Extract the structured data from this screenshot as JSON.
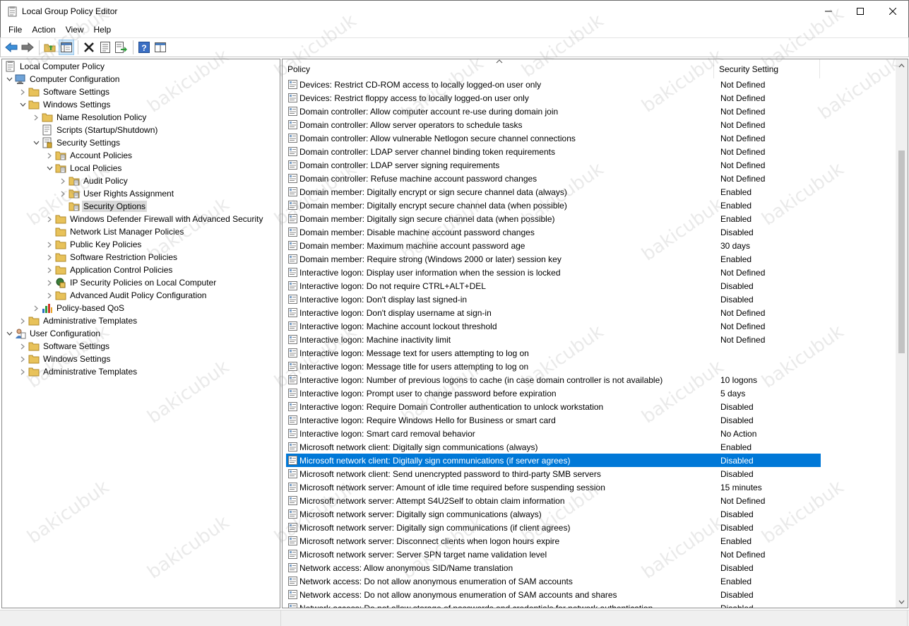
{
  "window": {
    "title": "Local Group Policy Editor",
    "minimize_icon": "minimize-icon",
    "maximize_icon": "maximize-icon",
    "close_icon": "close-icon"
  },
  "menu": [
    "File",
    "Action",
    "View",
    "Help"
  ],
  "toolbar": {
    "buttons": [
      "back-arrow-icon",
      "forward-arrow-icon",
      "up-folder-icon",
      "show-hide-tree-icon",
      "delete-icon",
      "properties-icon",
      "export-list-icon",
      "help-icon",
      "console-view-icon"
    ]
  },
  "tree": {
    "nodes": [
      {
        "label": "Local Computer Policy",
        "icon": "policy-root-icon"
      },
      {
        "label": "Computer Configuration",
        "icon": "computer-icon"
      },
      {
        "label": "Software Settings",
        "icon": "folder-icon"
      },
      {
        "label": "Windows Settings",
        "icon": "folder-icon"
      },
      {
        "label": "Name Resolution Policy",
        "icon": "folder-icon"
      },
      {
        "label": "Scripts (Startup/Shutdown)",
        "icon": "script-icon"
      },
      {
        "label": "Security Settings",
        "icon": "security-settings-icon"
      },
      {
        "label": "Account Policies",
        "icon": "policy-folder-icon"
      },
      {
        "label": "Local Policies",
        "icon": "policy-folder-icon"
      },
      {
        "label": "Audit Policy",
        "icon": "policy-folder-icon"
      },
      {
        "label": "User Rights Assignment",
        "icon": "policy-folder-icon"
      },
      {
        "label": "Security Options",
        "icon": "policy-folder-icon"
      },
      {
        "label": "Windows Defender Firewall with Advanced Security",
        "icon": "folder-icon"
      },
      {
        "label": "Network List Manager Policies",
        "icon": "folder-icon"
      },
      {
        "label": "Public Key Policies",
        "icon": "folder-icon"
      },
      {
        "label": "Software Restriction Policies",
        "icon": "folder-icon"
      },
      {
        "label": "Application Control Policies",
        "icon": "folder-icon"
      },
      {
        "label": "IP Security Policies on Local Computer",
        "icon": "ipsec-icon"
      },
      {
        "label": "Advanced Audit Policy Configuration",
        "icon": "folder-icon"
      },
      {
        "label": "Policy-based QoS",
        "icon": "qos-chart-icon"
      },
      {
        "label": "Administrative Templates",
        "icon": "folder-icon"
      },
      {
        "label": "User Configuration",
        "icon": "user-icon"
      },
      {
        "label": "Software Settings",
        "icon": "folder-icon"
      },
      {
        "label": "Windows Settings",
        "icon": "folder-icon"
      },
      {
        "label": "Administrative Templates",
        "icon": "folder-icon"
      }
    ]
  },
  "list": {
    "columns": [
      "Policy",
      "Security Setting"
    ],
    "selected_index": 28,
    "rows": [
      {
        "policy": "Devices: Restrict CD-ROM access to locally logged-on user only",
        "setting": "Not Defined"
      },
      {
        "policy": "Devices: Restrict floppy access to locally logged-on user only",
        "setting": "Not Defined"
      },
      {
        "policy": "Domain controller: Allow computer account re-use during domain join",
        "setting": "Not Defined"
      },
      {
        "policy": "Domain controller: Allow server operators to schedule tasks",
        "setting": "Not Defined"
      },
      {
        "policy": "Domain controller: Allow vulnerable Netlogon secure channel connections",
        "setting": "Not Defined"
      },
      {
        "policy": "Domain controller: LDAP server channel binding token requirements",
        "setting": "Not Defined"
      },
      {
        "policy": "Domain controller: LDAP server signing requirements",
        "setting": "Not Defined"
      },
      {
        "policy": "Domain controller: Refuse machine account password changes",
        "setting": "Not Defined"
      },
      {
        "policy": "Domain member: Digitally encrypt or sign secure channel data (always)",
        "setting": "Enabled"
      },
      {
        "policy": "Domain member: Digitally encrypt secure channel data (when possible)",
        "setting": "Enabled"
      },
      {
        "policy": "Domain member: Digitally sign secure channel data (when possible)",
        "setting": "Enabled"
      },
      {
        "policy": "Domain member: Disable machine account password changes",
        "setting": "Disabled"
      },
      {
        "policy": "Domain member: Maximum machine account password age",
        "setting": "30 days"
      },
      {
        "policy": "Domain member: Require strong (Windows 2000 or later) session key",
        "setting": "Enabled"
      },
      {
        "policy": "Interactive logon: Display user information when the session is locked",
        "setting": "Not Defined"
      },
      {
        "policy": "Interactive logon: Do not require CTRL+ALT+DEL",
        "setting": "Disabled"
      },
      {
        "policy": "Interactive logon: Don't display last signed-in",
        "setting": "Disabled"
      },
      {
        "policy": "Interactive logon: Don't display username at sign-in",
        "setting": "Not Defined"
      },
      {
        "policy": "Interactive logon: Machine account lockout threshold",
        "setting": "Not Defined"
      },
      {
        "policy": "Interactive logon: Machine inactivity limit",
        "setting": "Not Defined"
      },
      {
        "policy": "Interactive logon: Message text for users attempting to log on",
        "setting": ""
      },
      {
        "policy": "Interactive logon: Message title for users attempting to log on",
        "setting": ""
      },
      {
        "policy": "Interactive logon: Number of previous logons to cache (in case domain controller is not available)",
        "setting": "10 logons"
      },
      {
        "policy": "Interactive logon: Prompt user to change password before expiration",
        "setting": "5 days"
      },
      {
        "policy": "Interactive logon: Require Domain Controller authentication to unlock workstation",
        "setting": "Disabled"
      },
      {
        "policy": "Interactive logon: Require Windows Hello for Business or smart card",
        "setting": "Disabled"
      },
      {
        "policy": "Interactive logon: Smart card removal behavior",
        "setting": "No Action"
      },
      {
        "policy": "Microsoft network client: Digitally sign communications (always)",
        "setting": "Enabled"
      },
      {
        "policy": "Microsoft network client: Digitally sign communications (if server agrees)",
        "setting": "Disabled"
      },
      {
        "policy": "Microsoft network client: Send unencrypted password to third-party SMB servers",
        "setting": "Disabled"
      },
      {
        "policy": "Microsoft network server: Amount of idle time required before suspending session",
        "setting": "15 minutes"
      },
      {
        "policy": "Microsoft network server: Attempt S4U2Self to obtain claim information",
        "setting": "Not Defined"
      },
      {
        "policy": "Microsoft network server: Digitally sign communications (always)",
        "setting": "Disabled"
      },
      {
        "policy": "Microsoft network server: Digitally sign communications (if client agrees)",
        "setting": "Disabled"
      },
      {
        "policy": "Microsoft network server: Disconnect clients when logon hours expire",
        "setting": "Enabled"
      },
      {
        "policy": "Microsoft network server: Server SPN target name validation level",
        "setting": "Not Defined"
      },
      {
        "policy": "Network access: Allow anonymous SID/Name translation",
        "setting": "Disabled"
      },
      {
        "policy": "Network access: Do not allow anonymous enumeration of SAM accounts",
        "setting": "Enabled"
      },
      {
        "policy": "Network access: Do not allow anonymous enumeration of SAM accounts and shares",
        "setting": "Disabled"
      },
      {
        "policy": "Network access: Do not allow storage of passwords and credentials for network authentication",
        "setting": "Disabled"
      }
    ]
  },
  "watermark": "bakicubuk",
  "colors": {
    "selection": "#0078d7",
    "tree_selection": "#d9d9d9",
    "folder": "#e8c25a"
  }
}
